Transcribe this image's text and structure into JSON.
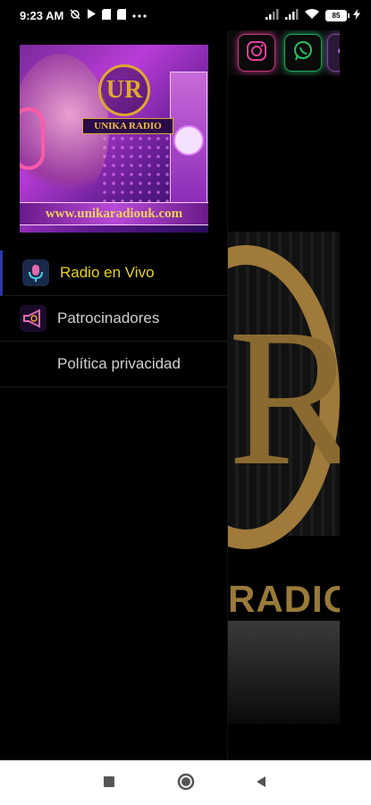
{
  "status_bar": {
    "time": "9:23 AM",
    "left_icons": [
      "sync-off-icon",
      "play-icon",
      "sim-icon",
      "sim-icon",
      "more-icon"
    ],
    "right_icons": [
      "signal-icon",
      "signal-icon",
      "wifi-icon",
      "battery-icon",
      "charging-icon"
    ],
    "battery_level": "85"
  },
  "drawer": {
    "header": {
      "logo_text": "UR",
      "brand_text": "UNIKA RADIO",
      "url_text": "www.unikaradiouk.com"
    },
    "menu_items": [
      {
        "label": "Radio en Vivo",
        "icon": "microphone-icon",
        "active": true
      },
      {
        "label": "Patrocinadores",
        "icon": "megaphone-icon",
        "active": false
      },
      {
        "label": "Política privacidad",
        "icon": "",
        "active": false
      }
    ]
  },
  "background_app": {
    "social_buttons": [
      "instagram-icon",
      "whatsapp-icon",
      "share-icon"
    ],
    "logo_text": "RADIO"
  },
  "colors": {
    "active_text": "#e8d21a",
    "active_indicator": "#2a3aa8",
    "gold": "#a07a3a"
  },
  "nav_bar": {
    "buttons": [
      "recents-button",
      "home-button",
      "back-button"
    ]
  }
}
